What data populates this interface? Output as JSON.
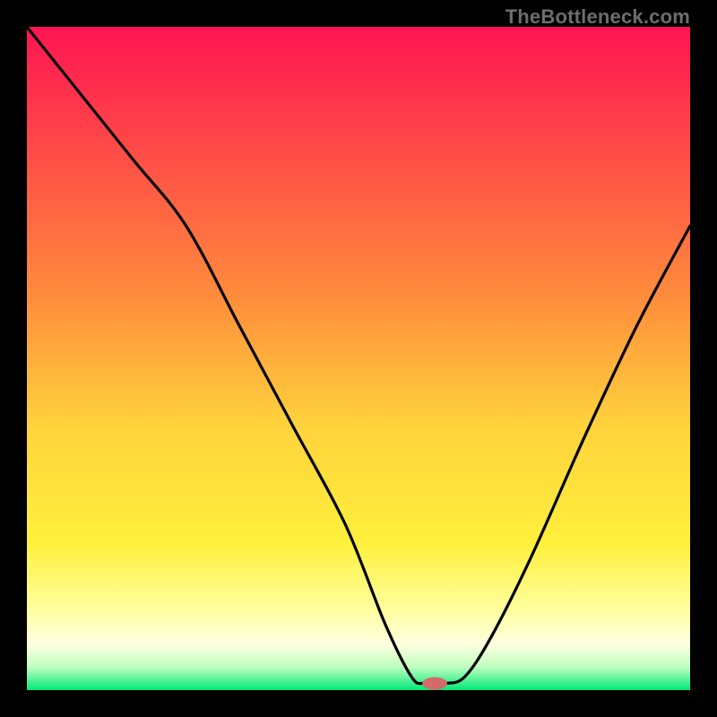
{
  "watermark": "TheBottleneck.com",
  "chart_data": {
    "type": "line",
    "title": "",
    "xlabel": "",
    "ylabel": "",
    "xlim": [
      0,
      100
    ],
    "ylim": [
      0,
      100
    ],
    "series": [
      {
        "name": "bottleneck-curve",
        "color": "#000000",
        "x": [
          0,
          8,
          16,
          24,
          32,
          40,
          48,
          54,
          58,
          60,
          63,
          66,
          70,
          76,
          84,
          92,
          100
        ],
        "y": [
          100,
          90,
          80,
          70,
          55,
          40,
          25,
          10,
          2,
          1,
          1,
          2,
          8,
          20,
          38,
          55,
          70
        ]
      }
    ],
    "marker": {
      "name": "min-marker",
      "x": 61.5,
      "y": 1,
      "color": "#d46a6a",
      "rx": 14,
      "ry": 7
    },
    "background": {
      "type": "gradient",
      "stops": [
        {
          "offset": 0,
          "color": "#ff1452"
        },
        {
          "offset": 0.4,
          "color": "#ff8a3c"
        },
        {
          "offset": 0.6,
          "color": "#ffd23c"
        },
        {
          "offset": 0.78,
          "color": "#fff03c"
        },
        {
          "offset": 0.88,
          "color": "#ffffa0"
        },
        {
          "offset": 0.93,
          "color": "#ffffe0"
        },
        {
          "offset": 0.965,
          "color": "#c0ffc0"
        },
        {
          "offset": 1.0,
          "color": "#00e878"
        }
      ]
    }
  }
}
